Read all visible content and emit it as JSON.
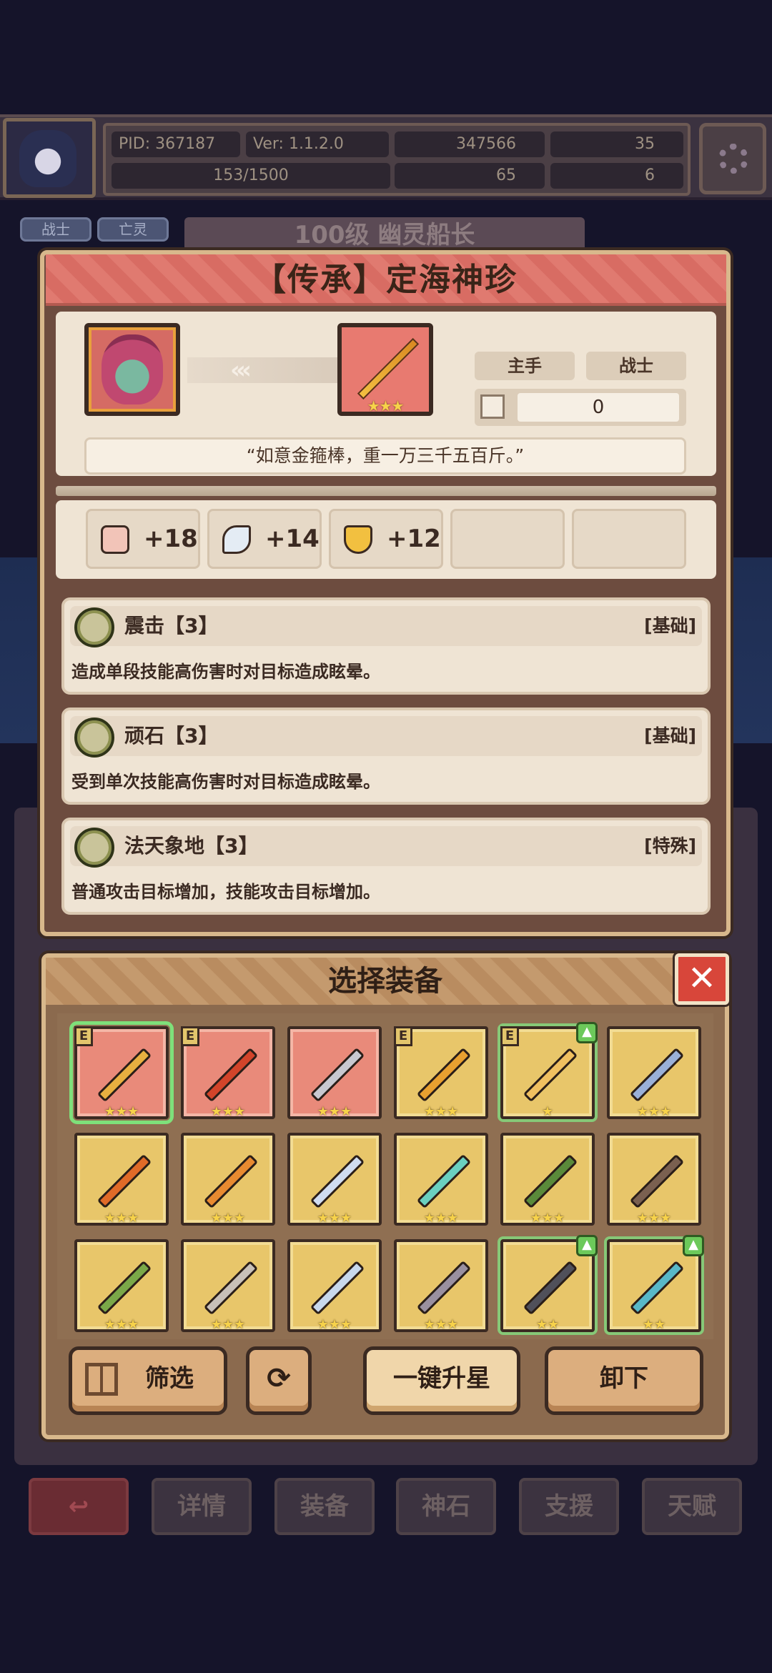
{
  "hud": {
    "pid": "PID: 367187",
    "version": "Ver: 1.1.2.0",
    "gold": "347566",
    "gems": "35",
    "exp": "153/1500",
    "clover": "65",
    "keys": "6"
  },
  "hero_tags": [
    "战士",
    "亡灵"
  ],
  "hero_banner": "100级 幽灵船长",
  "detail": {
    "title": "【传承】定海神珍",
    "slot_label": "主手",
    "class_label": "战士",
    "field_value": "0",
    "quote": "“如意金箍棒，重一万三千五百斤。”",
    "item_stars": "★★★",
    "stats": [
      {
        "icon": "fist-icon",
        "value": "+18"
      },
      {
        "icon": "feather-icon",
        "value": "+14"
      },
      {
        "icon": "shield-icon",
        "value": "+12"
      }
    ],
    "skills": [
      {
        "name": "震击【3】",
        "type": "[基础]",
        "desc": "造成单段技能高伤害时对目标造成眩晕。"
      },
      {
        "name": "顽石【3】",
        "type": "[基础]",
        "desc": "受到单次技能高伤害时对目标造成眩晕。"
      },
      {
        "name": "法天象地【3】",
        "type": "[特殊]",
        "desc": "普通攻击目标增加，技能攻击目标增加。"
      }
    ]
  },
  "picker": {
    "title": "选择装备",
    "close_label": "✕",
    "items": [
      {
        "bg": "red",
        "stars": "★★★",
        "e": "E",
        "selected": true,
        "up": false,
        "color": "#e8b040"
      },
      {
        "bg": "red",
        "stars": "★★★",
        "e": "E",
        "selected": false,
        "up": false,
        "color": "#d2442a"
      },
      {
        "bg": "red",
        "stars": "★★★",
        "e": "",
        "selected": false,
        "up": false,
        "color": "#c8c8d0"
      },
      {
        "bg": "gold",
        "stars": "★★★",
        "e": "E",
        "selected": false,
        "up": false,
        "color": "#e8a030"
      },
      {
        "bg": "gold",
        "stars": "★",
        "e": "E",
        "selected": false,
        "up": true,
        "color": "#f0c060"
      },
      {
        "bg": "gold",
        "stars": "★★★",
        "e": "",
        "selected": false,
        "up": false,
        "color": "#9ab0d8"
      },
      {
        "bg": "gold",
        "stars": "★★★",
        "e": "",
        "selected": false,
        "up": false,
        "color": "#e06a28"
      },
      {
        "bg": "gold",
        "stars": "★★★",
        "e": "",
        "selected": false,
        "up": false,
        "color": "#e88a30"
      },
      {
        "bg": "gold",
        "stars": "★★★",
        "e": "",
        "selected": false,
        "up": false,
        "color": "#d0dcf0"
      },
      {
        "bg": "gold",
        "stars": "★★★",
        "e": "",
        "selected": false,
        "up": false,
        "color": "#6ad0c0"
      },
      {
        "bg": "gold",
        "stars": "★★★",
        "e": "",
        "selected": false,
        "up": false,
        "color": "#5a8a3a"
      },
      {
        "bg": "gold",
        "stars": "★★★",
        "e": "",
        "selected": false,
        "up": false,
        "color": "#7a6050"
      },
      {
        "bg": "gold",
        "stars": "★★★",
        "e": "",
        "selected": false,
        "up": false,
        "color": "#7aa848"
      },
      {
        "bg": "gold",
        "stars": "★★★",
        "e": "",
        "selected": false,
        "up": false,
        "color": "#c8c0b8"
      },
      {
        "bg": "gold",
        "stars": "★★★",
        "e": "",
        "selected": false,
        "up": false,
        "color": "#c8d8ec"
      },
      {
        "bg": "gold",
        "stars": "★★★",
        "e": "",
        "selected": false,
        "up": false,
        "color": "#9a90a0"
      },
      {
        "bg": "gold",
        "stars": "★★",
        "e": "",
        "selected": false,
        "up": true,
        "color": "#50505a"
      },
      {
        "bg": "gold",
        "stars": "★★",
        "e": "",
        "selected": false,
        "up": true,
        "color": "#58b8c8"
      }
    ],
    "buttons": {
      "filter": "筛选",
      "upgrade_all": "一键升星",
      "unequip": "卸下"
    }
  },
  "bottom_tabs": [
    "详情",
    "装备",
    "神石",
    "支援",
    "天赋"
  ]
}
